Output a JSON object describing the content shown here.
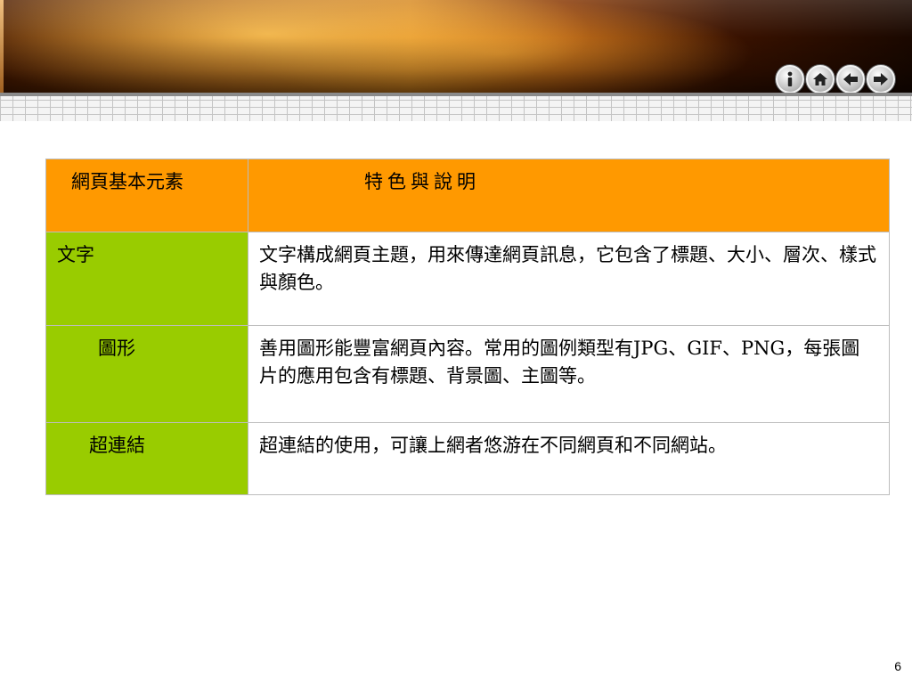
{
  "slide": {
    "page_number": "6"
  },
  "nav": {
    "buttons": [
      {
        "name": "info-icon"
      },
      {
        "name": "home-icon"
      },
      {
        "name": "arrow-left-icon"
      },
      {
        "name": "arrow-right-icon"
      }
    ]
  },
  "table": {
    "headers": [
      "網頁基本元素",
      "特色與說明"
    ],
    "rows": [
      {
        "element": "文字",
        "description": "文字構成網頁主題，用來傳達網頁訊息，它包含了標題、大小、層次、樣式與顏色。"
      },
      {
        "element": "圖形",
        "description": "善用圖形能豐富網頁內容。常用的圖例類型有JPG、GIF、PNG，每張圖片的應用包含有標題、背景圖、主圖等。"
      },
      {
        "element": "超連結",
        "description": "超連結的使用，可讓上網者悠游在不同網頁和不同網站。"
      }
    ]
  },
  "colors": {
    "header_bg": "#ff9900",
    "element_col_bg": "#99cc00",
    "banner_accent": "#c8720f"
  }
}
